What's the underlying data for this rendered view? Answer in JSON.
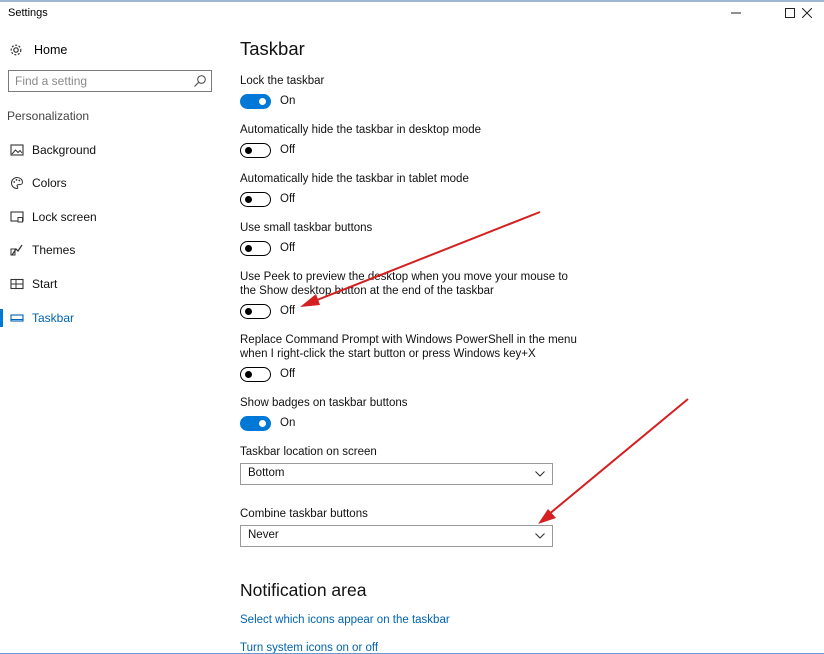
{
  "window": {
    "title": "Settings",
    "minimize": "—",
    "maximize": "☐",
    "close": "✕"
  },
  "sidebar": {
    "home_label": "Home",
    "search_placeholder": "Find a setting",
    "section_label": "Personalization",
    "items": [
      {
        "label": "Background",
        "icon": "picture-icon"
      },
      {
        "label": "Colors",
        "icon": "palette-icon"
      },
      {
        "label": "Lock screen",
        "icon": "lock-screen-icon"
      },
      {
        "label": "Themes",
        "icon": "themes-icon"
      },
      {
        "label": "Start",
        "icon": "start-icon"
      },
      {
        "label": "Taskbar",
        "icon": "taskbar-icon",
        "active": true
      }
    ]
  },
  "main": {
    "title": "Taskbar",
    "settings": [
      {
        "label": "Lock the taskbar",
        "state": "On"
      },
      {
        "label": "Automatically hide the taskbar in desktop mode",
        "state": "Off"
      },
      {
        "label": "Automatically hide the taskbar in tablet mode",
        "state": "Off"
      },
      {
        "label": "Use small taskbar buttons",
        "state": "Off"
      },
      {
        "label_line1": "Use Peek to preview the desktop when you move your mouse to",
        "label_line2": "the Show desktop button at the end of the taskbar",
        "state": "Off"
      },
      {
        "label_line1": "Replace Command Prompt with Windows PowerShell in the menu",
        "label_line2": "when I right-click the start button or press Windows key+X",
        "state": "Off"
      },
      {
        "label": "Show badges on taskbar buttons",
        "state": "On"
      }
    ],
    "location": {
      "label": "Taskbar location on screen",
      "value": "Bottom"
    },
    "combine": {
      "label": "Combine taskbar buttons",
      "value": "Never"
    },
    "notification": {
      "title": "Notification area",
      "link1": "Select which icons appear on the taskbar",
      "link2": "Turn system icons on or off"
    }
  },
  "colors": {
    "accent": "#0078d7",
    "link": "#0063b1",
    "annotation_arrow": "#d42020"
  }
}
